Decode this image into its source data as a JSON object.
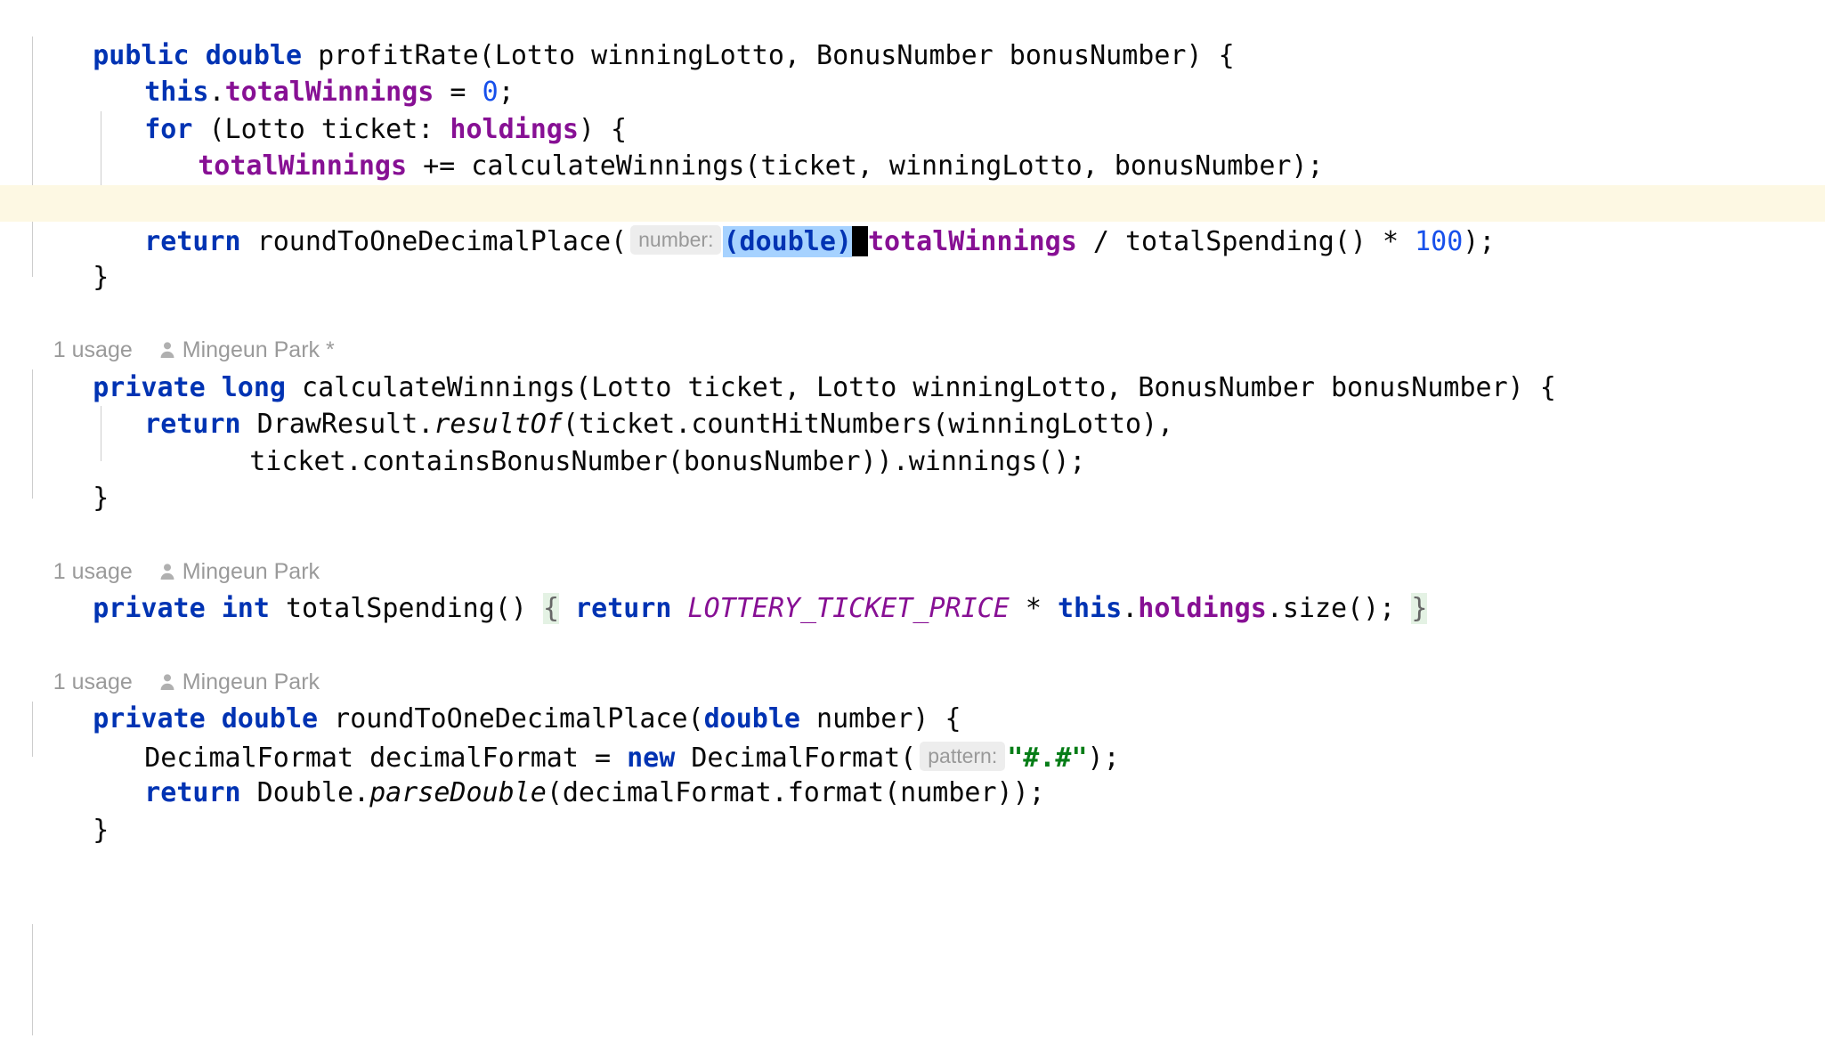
{
  "editor": {
    "language": "java",
    "theme": "IntelliJ Light",
    "colors": {
      "background": "#FFFFFF",
      "current_line": "#FDF8E3",
      "selection": "#A6D2FF",
      "caret": "#000000",
      "keyword": "#0033B3",
      "field": "#871094",
      "number": "#1750EB",
      "string": "#067D17",
      "inlay_hint_bg": "#EDEDED",
      "inlay_hint_fg": "#999999",
      "brace_match_bg": "#E4F2E4",
      "code_vision": "#9A9A9A",
      "indent_guide": "#CDCDCD"
    }
  },
  "code_vision": {
    "profit_rate": null,
    "calculate_winnings": {
      "usages": "1 usage",
      "author": "Mingeun Park *"
    },
    "total_spending": {
      "usages": "1 usage",
      "author": "Mingeun Park"
    },
    "round_to_one_decimal_place": {
      "usages": "1 usage",
      "author": "Mingeun Park"
    }
  },
  "inlay_hints": {
    "number": "number:",
    "pattern": "pattern:"
  },
  "selection": {
    "text": "(double)",
    "open_paren": "(",
    "type": "double",
    "close_paren": ")"
  },
  "lines": {
    "l1": {
      "kw_public": "public",
      "kw_double": "double",
      "sig": " profitRate(Lotto winningLotto, BonusNumber bonusNumber) {"
    },
    "l2": {
      "kw_this": "this",
      "dot": ".",
      "field": "totalWinnings",
      "eq": " = ",
      "num": "0",
      "semi": ";"
    },
    "l3": {
      "kw_for": "for",
      "mid": " (Lotto ticket: ",
      "field": "holdings",
      "tail": ") {"
    },
    "l4": {
      "field": "totalWinnings",
      "rest": " += calculateWinnings(ticket, winningLotto, bonusNumber);"
    },
    "l5": {
      "text": "}"
    },
    "l6": {
      "kw_return": "return",
      "call": " roundToOneDecimalPlace(",
      "field": "totalWinnings",
      "mid": " / totalSpending() * ",
      "num": "100",
      "tail": ");"
    },
    "l7": {
      "text": "}"
    },
    "l8": {
      "kw_private": "private",
      "kw_long": "long",
      "sig": " calculateWinnings(Lotto ticket, Lotto winningLotto, BonusNumber bonusNumber) {"
    },
    "l9": {
      "kw_return": "return",
      "cls": " DrawResult.",
      "method": "resultOf",
      "tail": "(ticket.countHitNumbers(winningLotto),"
    },
    "l10": {
      "text": "ticket.containsBonusNumber(bonusNumber)).winnings();"
    },
    "l11": {
      "text": "}"
    },
    "l12": {
      "kw_private": "private",
      "kw_int": "int",
      "name": " totalSpending() ",
      "brace_open": "{",
      "sp1": " ",
      "kw_return": "return",
      "sp2": " ",
      "const": "LOTTERY_TICKET_PRICE",
      "star": " * ",
      "kw_this": "this",
      "dot": ".",
      "field": "holdings",
      "size": ".size(); ",
      "brace_close": "}"
    },
    "l13": {
      "kw_private": "private",
      "kw_double": "double",
      "name": " roundToOneDecimalPlace(",
      "kw_param": "double",
      "tail": " number) {"
    },
    "l14": {
      "head": "DecimalFormat decimalFormat = ",
      "kw_new": "new",
      "mid": " DecimalFormat(",
      "str": "\"#.#\"",
      "tail": ");"
    },
    "l15": {
      "kw_return": "return",
      "cls": " Double.",
      "method": "parseDouble",
      "tail": "(decimalFormat.format(number));"
    },
    "l16": {
      "text": "}"
    }
  }
}
